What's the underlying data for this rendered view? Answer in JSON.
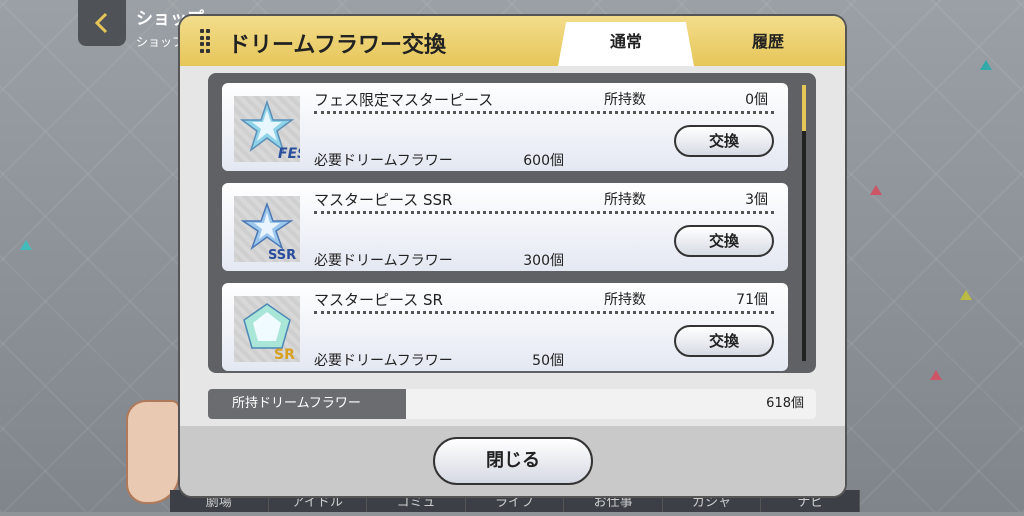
{
  "nav": {
    "title": "ショップ",
    "subtitle": "ショップ"
  },
  "bottom_nav": [
    "劇場",
    "アイドル",
    "コミュ",
    "ライブ",
    "お仕事",
    "ガシャ",
    "ナビ"
  ],
  "modal": {
    "title": "ドリームフラワー交換",
    "tabs": [
      {
        "label": "通常",
        "active": true
      },
      {
        "label": "履歴",
        "active": false
      }
    ],
    "items": [
      {
        "name": "フェス限定マスターピース",
        "owned_label": "所持数",
        "owned": "0個",
        "required_label": "必要ドリームフラワー",
        "required": "600個",
        "button": "交換",
        "badge": "FES",
        "icon": "fes-star-crystal-icon"
      },
      {
        "name": "マスターピース SSR",
        "owned_label": "所持数",
        "owned": "3個",
        "required_label": "必要ドリームフラワー",
        "required": "300個",
        "button": "交換",
        "badge": "SSR",
        "icon": "ssr-star-crystal-icon"
      },
      {
        "name": "マスターピース SR",
        "owned_label": "所持数",
        "owned": "71個",
        "required_label": "必要ドリームフラワー",
        "required": "50個",
        "button": "交換",
        "badge": "SR",
        "icon": "sr-pentagon-crystal-icon"
      }
    ],
    "flower": {
      "label": "所持ドリームフラワー",
      "value": "618個"
    },
    "close_label": "閉じる"
  },
  "colors": {
    "header": "#e6c659",
    "frame": "#5f6164",
    "accent_scroll": "#e6c659"
  }
}
